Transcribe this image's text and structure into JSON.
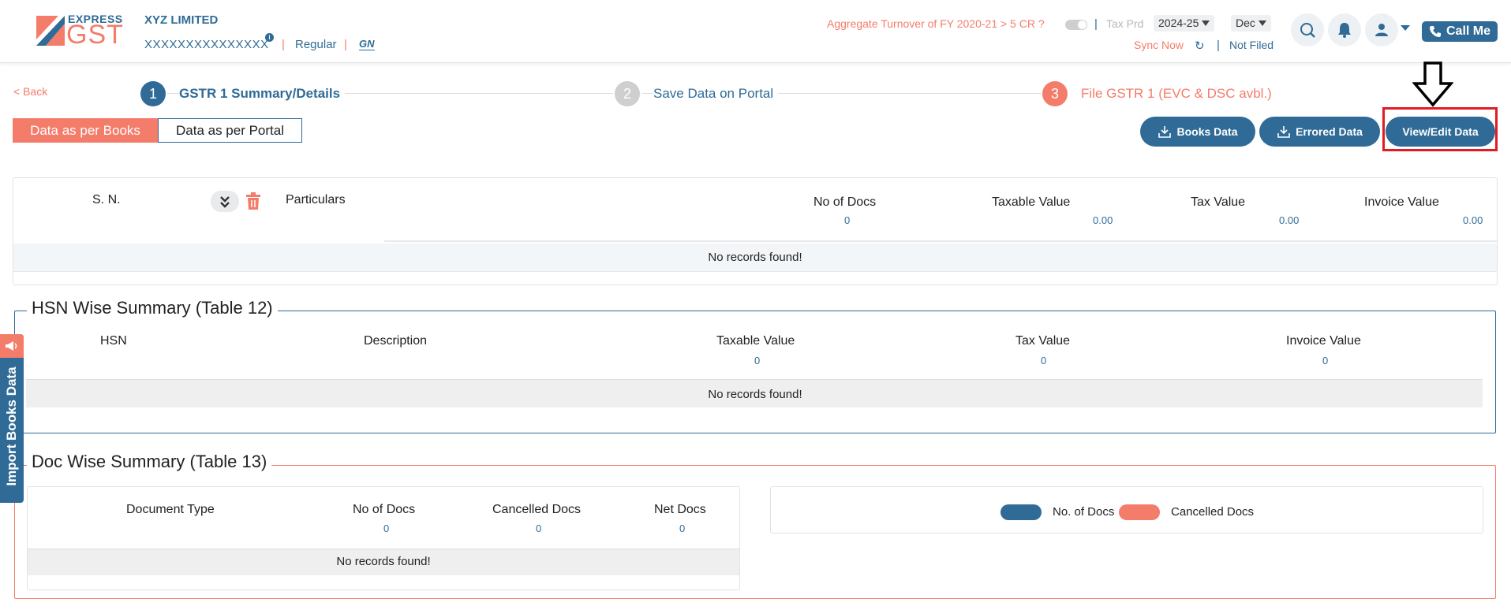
{
  "header": {
    "logo_express": "EXPRESS",
    "logo_gst": "GST",
    "company_name": "XYZ LIMITED",
    "gstin": "XXXXXXXXXXXXXXX",
    "gstin_badge": "i",
    "registration_type": "Regular",
    "gsn_logo": "GN",
    "turnover_question": "Aggregate Turnover of FY 2020-21 > 5 CR ?",
    "tax_period_label": "Tax Prd",
    "fy_selected": "2024-25",
    "month_selected": "Dec",
    "sync_now": "Sync Now",
    "filing_status": "Not Filed",
    "call_me": "Call Me",
    "separator": "|"
  },
  "nav": {
    "back": "< Back"
  },
  "steps": [
    {
      "num": "1",
      "label": "GSTR 1 Summary/Details"
    },
    {
      "num": "2",
      "label": "Save Data on Portal"
    },
    {
      "num": "3",
      "label": "File GSTR 1 (EVC & DSC avbl.)"
    }
  ],
  "view_tabs": {
    "books": "Data as per Books",
    "portal": "Data as per Portal"
  },
  "actions": {
    "books_data": "Books Data",
    "errored_data": "Errored Data",
    "view_edit": "View/Edit Data"
  },
  "summary_table": {
    "headers": {
      "sn": "S. N.",
      "particulars": "Particulars",
      "no_of_docs": "No of Docs",
      "taxable_value": "Taxable Value",
      "tax_value": "Tax Value",
      "invoice_value": "Invoice Value"
    },
    "totals": {
      "no_of_docs": "0",
      "taxable_value": "0.00",
      "tax_value": "0.00",
      "invoice_value": "0.00"
    },
    "empty": "No records found!"
  },
  "hsn_summary": {
    "title": "HSN Wise Summary (Table 12)",
    "headers": {
      "hsn": "HSN",
      "description": "Description",
      "taxable_value": "Taxable Value",
      "tax_value": "Tax Value",
      "invoice_value": "Invoice Value"
    },
    "totals": {
      "taxable_value": "0",
      "tax_value": "0",
      "invoice_value": "0"
    },
    "empty": "No records found!"
  },
  "doc_summary": {
    "title": "Doc Wise Summary (Table 13)",
    "headers": {
      "document_type": "Document Type",
      "no_of_docs": "No of Docs",
      "cancelled_docs": "Cancelled Docs",
      "net_docs": "Net Docs"
    },
    "totals": {
      "no_of_docs": "0",
      "cancelled_docs": "0",
      "net_docs": "0"
    },
    "empty": "No records found!",
    "chart_legend": {
      "no_of_docs": "No. of Docs",
      "cancelled_docs": "Cancelled Docs"
    }
  },
  "side_tab": {
    "label": "Import Books Data"
  },
  "colors": {
    "primary": "#2f6b96",
    "accent": "#f47c6a",
    "highlight": "#e11b22"
  },
  "icons": [
    "search-icon",
    "bell-icon",
    "user-icon",
    "phone-icon",
    "sync-icon",
    "download-icon",
    "double-chevron-down-icon",
    "trash-icon",
    "megaphone-icon",
    "down-arrow-icon"
  ]
}
